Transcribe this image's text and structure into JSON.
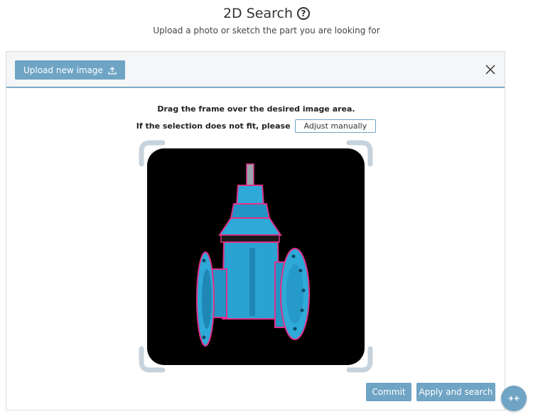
{
  "header": {
    "title": "2D Search",
    "subtitle": "Upload a photo or sketch the part you are looking for"
  },
  "toolbar": {
    "upload_label": "Upload new image"
  },
  "instructions": {
    "line1": "Drag the frame over the desired image area.",
    "line2": "If the selection does not fit, please",
    "adjust_label": "Adjust manually"
  },
  "actions": {
    "commit_label": "Commit",
    "apply_label": "Apply and search"
  },
  "icons": {
    "help": "help-circle-icon",
    "upload": "upload-icon",
    "close": "close-icon",
    "collapse": "collapse-arrows-icon"
  },
  "colors": {
    "accent": "#6fa4c4",
    "outline": "#e0308a",
    "part": "#2ea9d8"
  }
}
